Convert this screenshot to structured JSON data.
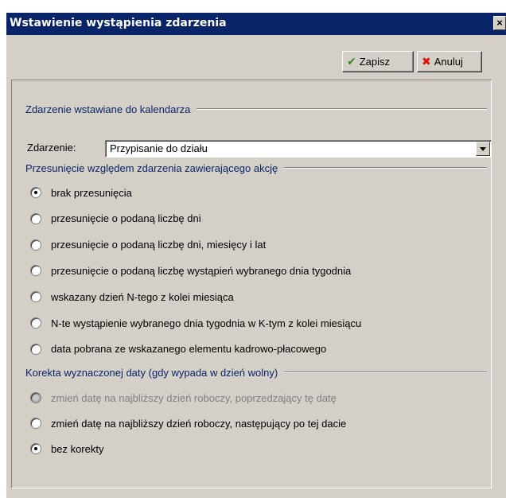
{
  "window": {
    "title": "Wstawienie wystąpienia zdarzenia",
    "close_glyph": "×"
  },
  "toolbar": {
    "save_label": "Zapisz",
    "cancel_label": "Anuluj",
    "save_icon": "check-icon",
    "cancel_icon": "x-icon"
  },
  "event_group": {
    "title": "Zdarzenie wstawiane do kalendarza",
    "field_label": "Zdarzenie:",
    "selected_value": "Przypisanie do działu"
  },
  "shift_group": {
    "title": "Przesunięcie względem zdarzenia zawierającego akcję",
    "options": [
      {
        "label": "brak przesunięcia",
        "checked": true,
        "enabled": true
      },
      {
        "label": "przesunięcie o podaną liczbę dni",
        "checked": false,
        "enabled": true
      },
      {
        "label": "przesunięcie o podaną liczbę dni, miesięcy i lat",
        "checked": false,
        "enabled": true
      },
      {
        "label": "przesunięcie o podaną liczbę wystąpień wybranego dnia tygodnia",
        "checked": false,
        "enabled": true
      },
      {
        "label": "wskazany dzień N-tego z kolei miesiąca",
        "checked": false,
        "enabled": true
      },
      {
        "label": "N-te wystąpienie wybranego dnia tygodnia w K-tym z kolei miesiącu",
        "checked": false,
        "enabled": true
      },
      {
        "label": "data pobrana ze wskazanego elementu kadrowo-płacowego",
        "checked": false,
        "enabled": true
      }
    ]
  },
  "correction_group": {
    "title": "Korekta wyznaczonej daty (gdy wypada w dzień wolny)",
    "options": [
      {
        "label": "zmień datę na najbliższy dzień roboczy, poprzedzający tę datę",
        "checked": false,
        "enabled": false
      },
      {
        "label": "zmień datę na najbliższy dzień roboczy, następujący po tej dacie",
        "checked": false,
        "enabled": true
      },
      {
        "label": "bez korekty",
        "checked": true,
        "enabled": true
      }
    ]
  },
  "colors": {
    "titlebar": "#0a246a",
    "group_title": "#0a246a",
    "dialog_bg": "#d4d0c8"
  }
}
